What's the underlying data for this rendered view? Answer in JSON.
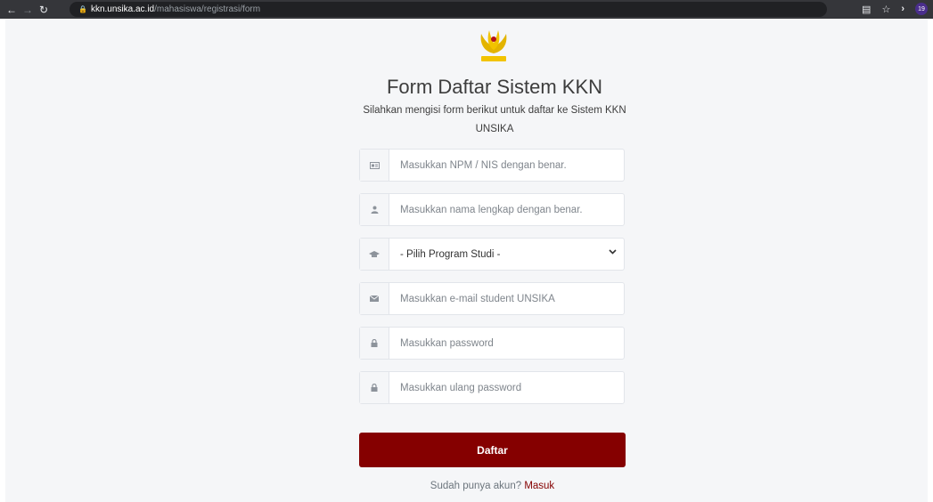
{
  "browser": {
    "host": "kkn.unsika.ac.id",
    "path": "/mahasiswa/registrasi/form",
    "extension_badge": "19"
  },
  "header": {
    "title": "Form Daftar Sistem KKN",
    "subtitle": "Silahkan mengisi form berikut untuk daftar ke Sistem KKN UNSIKA"
  },
  "form": {
    "npm_placeholder": "Masukkan NPM / NIS dengan benar.",
    "name_placeholder": "Masukkan nama lengkap dengan benar.",
    "program_selected": "- Pilih Program Studi -",
    "email_placeholder": "Masukkan e-mail student UNSIKA",
    "password_placeholder": "Masukkan password",
    "password_confirm_placeholder": "Masukkan ulang password",
    "submit_label": "Daftar"
  },
  "footer": {
    "prompt": "Sudah punya akun?",
    "login_label": "Masuk"
  },
  "colors": {
    "primary": "#850000",
    "background": "#f5f6f8"
  }
}
